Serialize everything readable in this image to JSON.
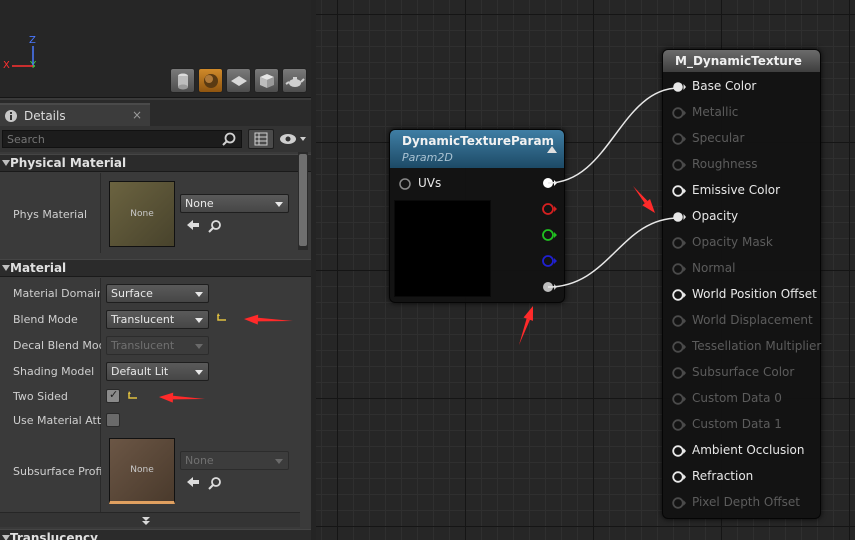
{
  "viewport": {
    "axis_z": "Z",
    "axis_x": "X",
    "axis_y": "Y",
    "preview_tools": [
      "cylinder-icon",
      "sphere-icon",
      "plane-icon",
      "cube-icon",
      "teapot-icon"
    ]
  },
  "details": {
    "tab_label": "Details",
    "close_glyph": "×",
    "search_placeholder": "Search",
    "categories": {
      "physical_material": "Physical Material",
      "material": "Material",
      "translucency": "Translucency"
    },
    "phys_material": {
      "label": "Phys Material",
      "thumb_text": "None",
      "value": "None"
    },
    "material_domain": {
      "label": "Material Domain",
      "value": "Surface"
    },
    "blend_mode": {
      "label": "Blend Mode",
      "value": "Translucent"
    },
    "decal_blend_mode": {
      "label": "Decal Blend Mode",
      "value": "Translucent"
    },
    "shading_model": {
      "label": "Shading Model",
      "value": "Default Lit"
    },
    "two_sided": {
      "label": "Two Sided",
      "checked": true
    },
    "use_material_attributes": {
      "label": "Use Material Attributes",
      "checked": false
    },
    "subsurface_profile": {
      "label": "Subsurface Profile",
      "thumb_text": "None",
      "value": "None"
    }
  },
  "graph": {
    "param_node": {
      "title": "DynamicTextureParam",
      "subtitle": "Param2D",
      "input_label": "UVs",
      "output_pin_colors": [
        "#ffffff",
        "#d42020",
        "#20c020",
        "#2020d0",
        "#bdbdbd"
      ]
    },
    "result_node": {
      "title": "M_DynamicTexture",
      "pins": [
        {
          "label": "Base Color",
          "active": true,
          "connected": true
        },
        {
          "label": "Metallic",
          "active": false,
          "connected": false
        },
        {
          "label": "Specular",
          "active": false,
          "connected": false
        },
        {
          "label": "Roughness",
          "active": false,
          "connected": false
        },
        {
          "label": "Emissive Color",
          "active": true,
          "connected": false
        },
        {
          "label": "Opacity",
          "active": true,
          "connected": true
        },
        {
          "label": "Opacity Mask",
          "active": false,
          "connected": false
        },
        {
          "label": "Normal",
          "active": false,
          "connected": false
        },
        {
          "label": "World Position Offset",
          "active": true,
          "connected": false
        },
        {
          "label": "World Displacement",
          "active": false,
          "connected": false
        },
        {
          "label": "Tessellation Multiplier",
          "active": false,
          "connected": false
        },
        {
          "label": "Subsurface Color",
          "active": false,
          "connected": false
        },
        {
          "label": "Custom Data 0",
          "active": false,
          "connected": false
        },
        {
          "label": "Custom Data 1",
          "active": false,
          "connected": false
        },
        {
          "label": "Ambient Occlusion",
          "active": true,
          "connected": false
        },
        {
          "label": "Refraction",
          "active": true,
          "connected": false
        },
        {
          "label": "Pixel Depth Offset",
          "active": false,
          "connected": false
        }
      ]
    },
    "annotation_color": "#ff2a2a"
  }
}
